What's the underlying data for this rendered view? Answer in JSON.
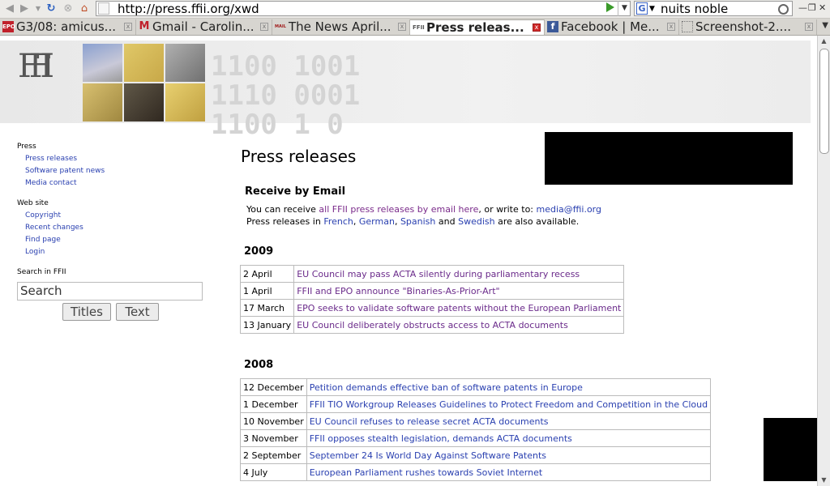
{
  "browser": {
    "url": "http://press.ffii.org/xwd",
    "search_value": "nuits noble",
    "search_engine": "G",
    "tabs": [
      {
        "favicon": "EPO",
        "title": "G3/08: amicus...",
        "active": false
      },
      {
        "favicon": "M",
        "title": "Gmail - Carolin...",
        "active": false
      },
      {
        "favicon": "MAIL",
        "title": "The News April...",
        "active": false
      },
      {
        "favicon": "FFII",
        "title": "Press releas...",
        "active": true
      },
      {
        "favicon": "f",
        "title": "Facebook | Me...",
        "active": false
      },
      {
        "favicon": "",
        "title": "Screenshot-2....",
        "active": false
      }
    ]
  },
  "banner": {
    "logo_text": "FFII"
  },
  "sidebar": {
    "press_heading": "Press",
    "press_links": [
      "Press releases",
      "Software patent news",
      "Media contact"
    ],
    "site_heading": "Web site",
    "site_links": [
      "Copyright",
      "Recent changes",
      "Find page",
      "Login"
    ],
    "search_heading": "Search in FFII",
    "search_placeholder": "Search",
    "titles_button": "Titles",
    "text_button": "Text"
  },
  "main": {
    "title": "Press releases",
    "email_heading": "Receive by Email",
    "line1_prefix": "You can receive ",
    "line1_link": "all FFII press releases by email here",
    "line1_mid": ", or write to: ",
    "line1_email": "media@ffii.org",
    "line2_prefix": "Press releases in ",
    "lang_french": "French",
    "lang_german": "German",
    "lang_spanish": "Spanish",
    "lang_and": " and ",
    "lang_swedish": "Swedish",
    "line2_suffix": " are also available.",
    "sections": [
      {
        "year": "2009",
        "items": [
          {
            "date": "2 April",
            "title": "EU Council may pass ACTA silently during parliamentary recess"
          },
          {
            "date": "1 April",
            "title": "FFII and EPO announce \"Binaries-As-Prior-Art\""
          },
          {
            "date": "17 March",
            "title": "EPO seeks to validate software patents without the European Parliament"
          },
          {
            "date": "13 January",
            "title": "EU Council deliberately obstructs access to ACTA documents"
          }
        ]
      },
      {
        "year": "2008",
        "items": [
          {
            "date": "12 December",
            "title": "Petition demands effective ban of software patents in Europe"
          },
          {
            "date": "1 December",
            "title": "FFII TIO Workgroup Releases Guidelines to Protect Freedom and Competition in the Cloud"
          },
          {
            "date": "10 November",
            "title": "EU Council refuses to release secret ACTA documents"
          },
          {
            "date": "3 November",
            "title": "FFII opposes stealth legislation, demands ACTA documents"
          },
          {
            "date": "2 September",
            "title": "September 24 Is World Day Against Software Patents"
          },
          {
            "date": "4 July",
            "title": "European Parliament rushes towards Soviet Internet"
          }
        ]
      }
    ]
  }
}
